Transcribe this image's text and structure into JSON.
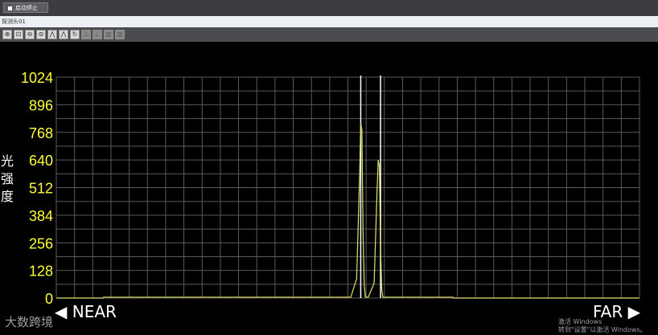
{
  "toolbar_top": {
    "stop_button_label": "启动停止"
  },
  "strip": {
    "label": "探测头01"
  },
  "tools": [
    {
      "icon": "zoom-in-icon",
      "glyph": "⊕",
      "enabled": true
    },
    {
      "icon": "zoom-fit-icon",
      "glyph": "⊡",
      "enabled": true
    },
    {
      "icon": "zoom-out-icon",
      "glyph": "⊖",
      "enabled": true
    },
    {
      "icon": "zoom-reset-icon",
      "glyph": "⊜",
      "enabled": true
    },
    {
      "icon": "peak-icon",
      "glyph": "⋀",
      "enabled": true
    },
    {
      "icon": "peak-alt-icon",
      "glyph": "⋀",
      "enabled": true
    },
    {
      "icon": "refresh-icon",
      "glyph": "↻",
      "enabled": true
    },
    {
      "icon": "measure-icon",
      "glyph": "⊥",
      "enabled": false
    },
    {
      "icon": "measure-alt-icon",
      "glyph": "⊥",
      "enabled": false
    },
    {
      "icon": "histogram-icon",
      "glyph": "▥",
      "enabled": false
    },
    {
      "icon": "histogram-alt-icon",
      "glyph": "▥",
      "enabled": false
    }
  ],
  "colors": {
    "curve": "#e3e36a",
    "axis_text": "#ffff33",
    "grid": "#5a5a5a",
    "marker": "#ffffff",
    "background": "#000000"
  },
  "chart_data": {
    "type": "line",
    "ylabel": "光\n强\n度",
    "xlabel_left": "◀ NEAR",
    "xlabel_right": "FAR ▶",
    "ylim": [
      0,
      1024
    ],
    "xlim": [
      0,
      1
    ],
    "yticks": [
      0,
      128,
      256,
      384,
      512,
      640,
      768,
      896,
      1024
    ],
    "grid": true,
    "grid_columns": 32,
    "series": [
      {
        "x": [
          0,
          0.08,
          0.081,
          0.5,
          0.505,
          0.515,
          0.52,
          0.522,
          0.524,
          0.526,
          0.528,
          0.53,
          0.535,
          0.545,
          0.55,
          0.552,
          0.554,
          0.556,
          0.558,
          0.56,
          0.565,
          0.68,
          0.681,
          1
        ],
        "y": [
          0,
          0,
          4,
          4,
          4,
          90,
          560,
          810,
          780,
          300,
          60,
          4,
          4,
          70,
          500,
          640,
          610,
          230,
          40,
          4,
          4,
          4,
          0,
          0
        ]
      }
    ],
    "markers_x": [
      0.522,
      0.556
    ]
  },
  "watermark": "大数跨境",
  "activation_notice": {
    "line1": "激活 Windows",
    "line2": "转到\"设置\"以激活 Windows。"
  }
}
